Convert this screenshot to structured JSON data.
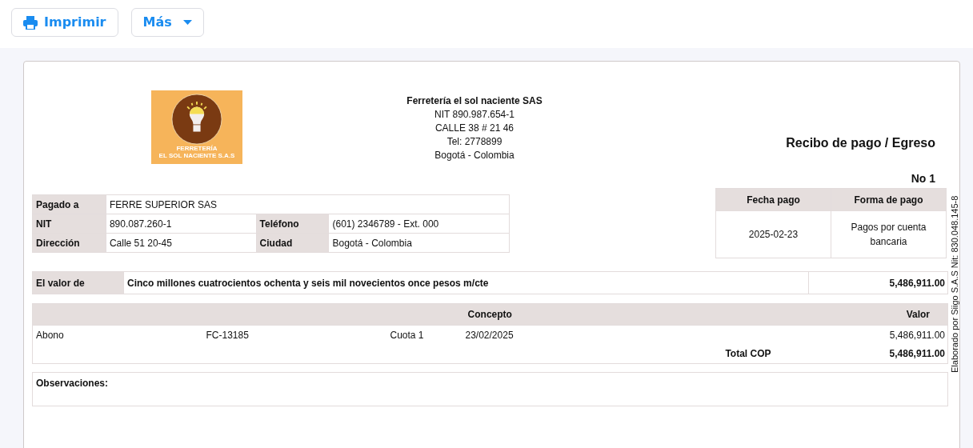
{
  "toolbar": [
    {
      "kind": "print",
      "label": "Imprimir"
    },
    {
      "kind": "dropdown",
      "label": "Más"
    }
  ],
  "logo": {
    "lines": [
      "FERRETERÍA",
      "EL SOL NACIENTE S.A.S"
    ]
  },
  "company": {
    "name": "Ferretería el sol naciente SAS",
    "lines": [
      "NIT 890.987.654-1",
      "CALLE 38 # 21 46",
      "Tel: 2778899",
      "Bogotá - Colombia"
    ]
  },
  "document": {
    "title": "Recibo de pago / Egreso",
    "number": "No 1"
  },
  "payee": [
    {
      "label": "Pagado a",
      "value": "FERRE SUPERIOR SAS"
    },
    {
      "label": "NIT",
      "value": "890.087.260-1",
      "label2": "Teléfono",
      "value2": "(601) 2346789 - Ext. 000"
    },
    {
      "label": "Dirección",
      "value": "Calle 51 20-45",
      "label2": "Ciudad",
      "value2": "Bogotá - Colombia"
    }
  ],
  "payment": {
    "headers": [
      "Fecha pago",
      "Forma de pago"
    ],
    "values": [
      "2025-02-23",
      "Pagos por cuenta bancaria"
    ]
  },
  "amount": {
    "label": "El valor de",
    "words": "Cinco millones cuatrocientos ochenta y seis mil novecientos once pesos m/cte",
    "value": "5,486,911.00"
  },
  "concepts": {
    "headers": [
      "Concepto",
      "Valor"
    ],
    "rows": [
      {
        "cells": [
          "Abono",
          "FC-13185",
          "Cuota 1",
          "23/02/2025"
        ],
        "value": "5,486,911.00"
      }
    ],
    "total_label": "Total COP",
    "total": "5,486,911.00"
  },
  "observations": {
    "label": "Observaciones:"
  },
  "side_note": "Elaborado por Siigo S.A.S Nit: 830.048.145-8"
}
